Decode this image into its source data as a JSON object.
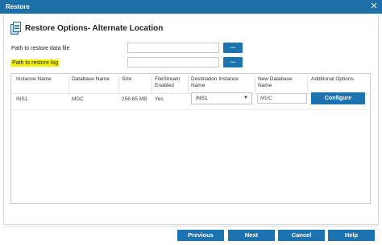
{
  "window": {
    "title": "Restore",
    "close_glyph": "✕"
  },
  "heading": {
    "title": "Restore Options- Alternate Location",
    "icon": "documents-icon"
  },
  "form": {
    "data_file_label": "Path to restore data file",
    "data_file_value": "",
    "log_label": "Path to restore log",
    "log_value": "",
    "browse_label": "..."
  },
  "table": {
    "columns": [
      "Instance Name",
      "Database Name",
      "Size",
      "FileStream Enabled",
      "Destination Instance Name",
      "New Database Name",
      "Additional Options"
    ],
    "rows": [
      {
        "instance": "INS1",
        "database": "MDC",
        "size": "256.65 MB",
        "filestream": "Yes",
        "destination": "INS1",
        "new_database": "MDC",
        "action_label": "Configure"
      }
    ]
  },
  "footer": {
    "previous": "Previous",
    "next": "Next",
    "cancel": "Cancel",
    "help": "Help"
  },
  "colors": {
    "accent": "#1d73b0",
    "titlebar": "#1d6fa8",
    "highlight": "#f3f300"
  }
}
